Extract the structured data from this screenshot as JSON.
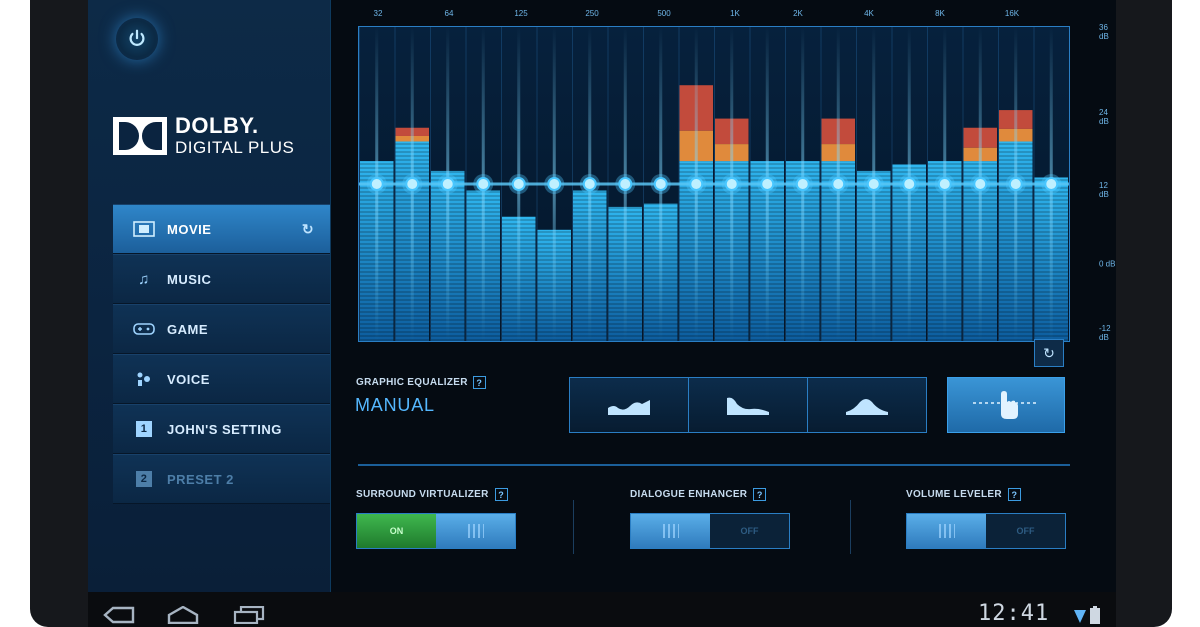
{
  "sidebar": {
    "brand": {
      "line1": "DOLBY.",
      "line2": "DIGITAL PLUS"
    },
    "items": [
      {
        "label": "MOVIE",
        "icon": "film-icon",
        "state": "active"
      },
      {
        "label": "MUSIC",
        "icon": "music-note-icon",
        "state": "normal"
      },
      {
        "label": "GAME",
        "icon": "gamepad-icon",
        "state": "normal"
      },
      {
        "label": "VOICE",
        "icon": "voice-icon",
        "state": "normal"
      },
      {
        "label": "JOHN'S SETTING",
        "icon": "number-1-icon",
        "number": "1",
        "state": "normal"
      },
      {
        "label": "PRESET 2",
        "icon": "number-2-icon",
        "number": "2",
        "state": "disabled"
      }
    ]
  },
  "equalizer": {
    "freq_labels": [
      "32",
      "64",
      "125",
      "250",
      "500",
      "1K",
      "2K",
      "4K",
      "8K",
      "16K"
    ],
    "db_labels": [
      "36 dB",
      "24 dB",
      "12 dB",
      "0 dB",
      "-12 dB"
    ],
    "bands_level_db": [
      15.5,
      18.5,
      14,
      11,
      7,
      5,
      11,
      8.5,
      9,
      15.5,
      15.5,
      15.5,
      15.5,
      15.5,
      14,
      15,
      15.5,
      15.5,
      18.5,
      13
    ],
    "peaks_level_db": [
      null,
      20.6,
      null,
      null,
      null,
      null,
      null,
      null,
      null,
      27.1,
      22,
      null,
      null,
      22,
      null,
      null,
      null,
      20.6,
      23.3,
      null
    ],
    "handles_level_db": 12,
    "colors": {
      "bar": "#1a8fd6",
      "peak_orange": "#e08a3c",
      "peak_red": "#c24b3c",
      "handle": "#49c7ff"
    }
  },
  "controls": {
    "graphic_eq_label": "GRAPHIC EQUALIZER",
    "graphic_eq_mode": "MANUAL",
    "presets": [
      "open-eq-icon",
      "rich-eq-icon",
      "focused-eq-icon"
    ],
    "manual_icon": "hand-drag-icon",
    "surround": {
      "label": "SURROUND VIRTUALIZER",
      "state": "ON",
      "on_text": "ON"
    },
    "dialogue": {
      "label": "DIALOGUE ENHANCER",
      "state": "OFF",
      "off_text": "OFF"
    },
    "volume": {
      "label": "VOLUME LEVELER",
      "state": "OFF",
      "off_text": "OFF"
    }
  },
  "statusbar": {
    "time": "12:41",
    "icons": [
      "back-icon",
      "home-icon",
      "recent-apps-icon",
      "wifi-icon",
      "battery-icon"
    ]
  }
}
